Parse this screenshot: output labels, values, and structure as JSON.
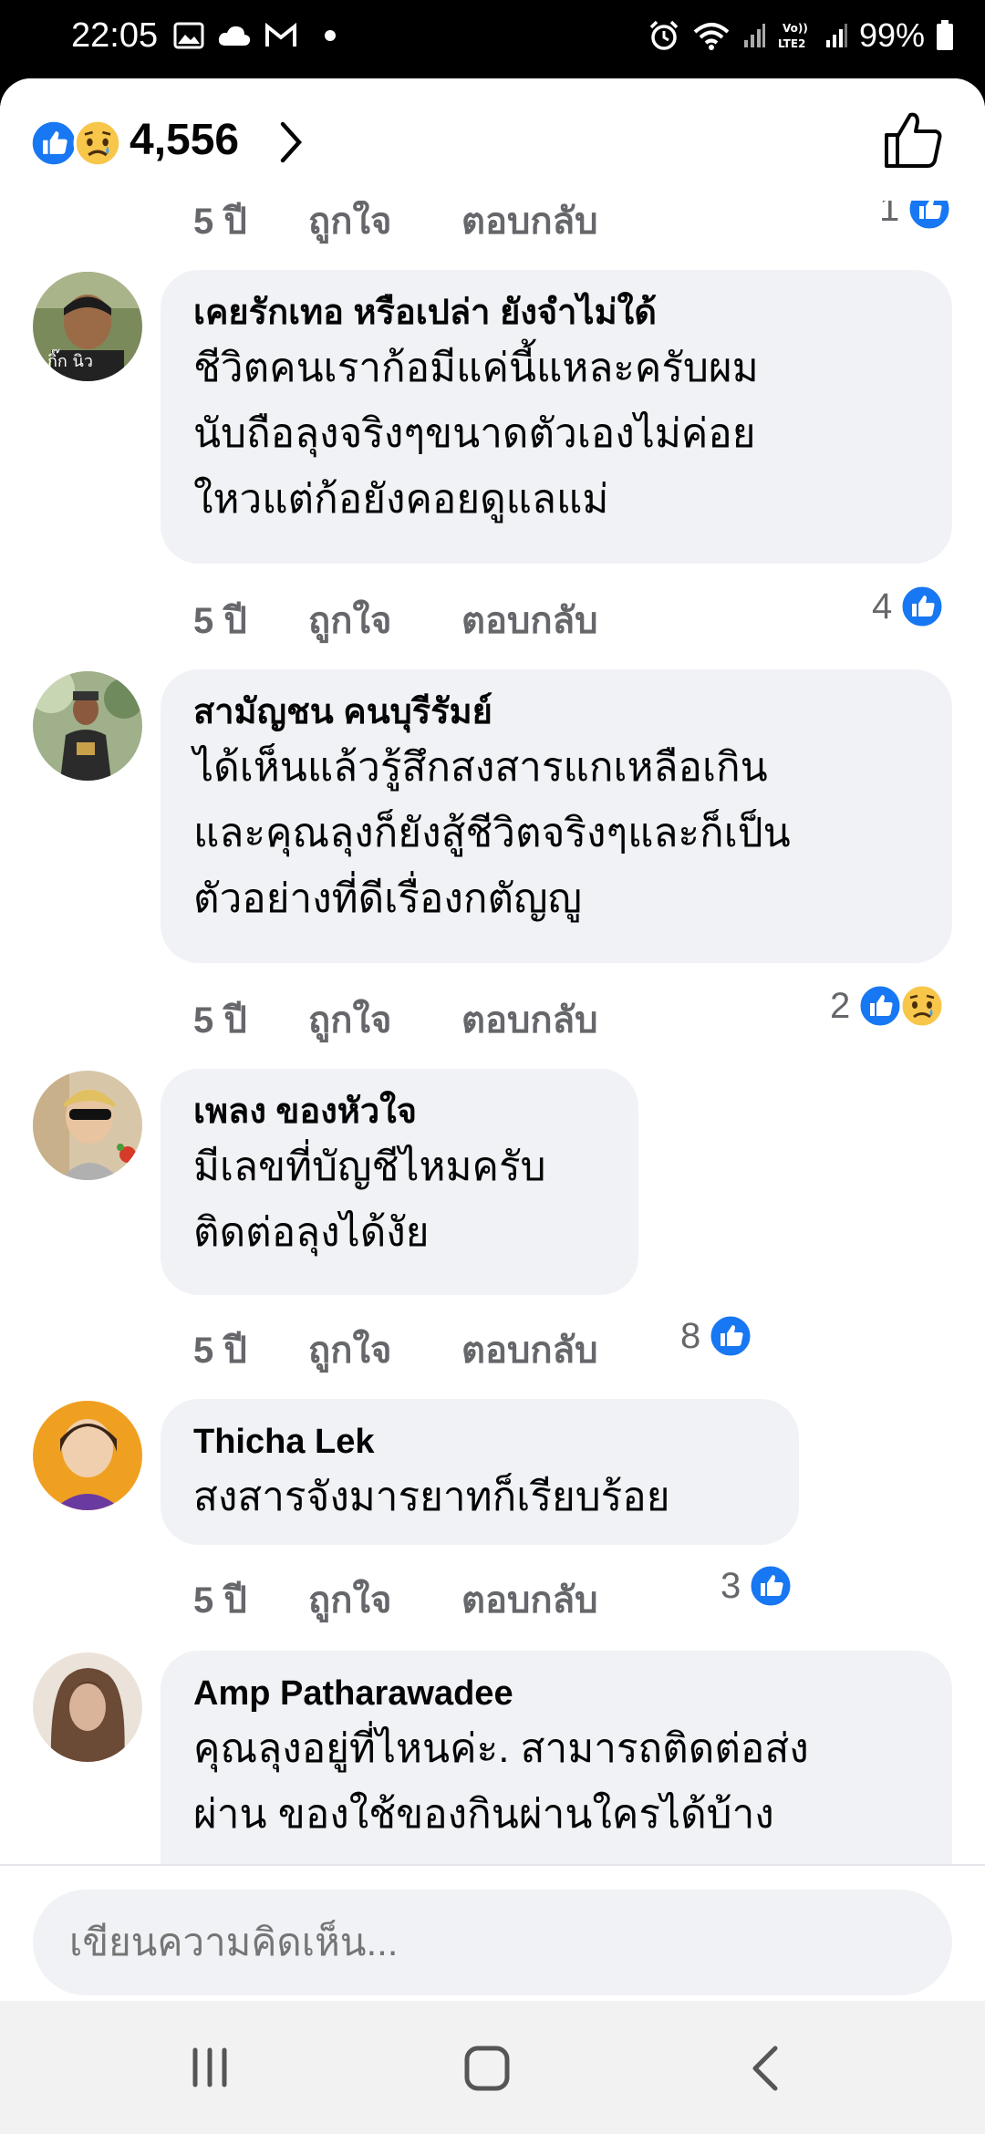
{
  "status_bar": {
    "time": "22:05",
    "battery": "99%"
  },
  "header": {
    "reaction_count": "4,556"
  },
  "partial_row": {
    "time": "5 ปี",
    "like": "ถูกใจ",
    "reply": "ตอบกลับ",
    "count": "1"
  },
  "comments": [
    {
      "name": "เคยรักเทอ หรือเปล่า ยังจำไม่ใด้",
      "text": "ชีวิตคนเราก้อมีแค่นี้แหละครับผม\nนับถือลุงจริงๆขนาดตัวเองไม่ค่อย\nใหวแต่ก้อยังคอยดูแลแม่",
      "avatar_label": "กิ๊ก นิว",
      "time": "5 ปี",
      "like": "ถูกใจ",
      "reply": "ตอบกลับ",
      "reaction_count": "4"
    },
    {
      "name": "สามัญชน คนบุรีรัมย์",
      "text": "ได้เห็นแล้วรู้สึกสงสารแกเหลือเกิน\nและคุณลุงก็ยังสู้ชีวิตจริงๆและก็เป็น\nตัวอย่างที่ดีเรื่องกตัญญู",
      "time": "5 ปี",
      "like": "ถูกใจ",
      "reply": "ตอบกลับ",
      "reaction_count": "2"
    },
    {
      "name": "เพลง ของหัวใจ",
      "text": "มีเลขที่บัญชีไหมครับ\nติดต่อลุงได้งัย",
      "time": "5 ปี",
      "like": "ถูกใจ",
      "reply": "ตอบกลับ",
      "reaction_count": "8"
    },
    {
      "name": "Thicha Lek",
      "text": "สงสารจังมารยาทก็เรียบร้อย",
      "time": "5 ปี",
      "like": "ถูกใจ",
      "reply": "ตอบกลับ",
      "reaction_count": "3"
    },
    {
      "name": "Amp Patharawadee",
      "text": "คุณลุงอยู่ที่ไหนค่ะ. สามารถติดต่อส่ง\nผ่าน ของใช้ของกินผ่านใครได้บ้าง"
    }
  ],
  "composer": {
    "placeholder": "เขียนความคิดเห็น..."
  },
  "colors": {
    "like_blue": "#1877f2",
    "bubble_bg": "#f0f2f5",
    "meta_gray": "#65676b"
  }
}
